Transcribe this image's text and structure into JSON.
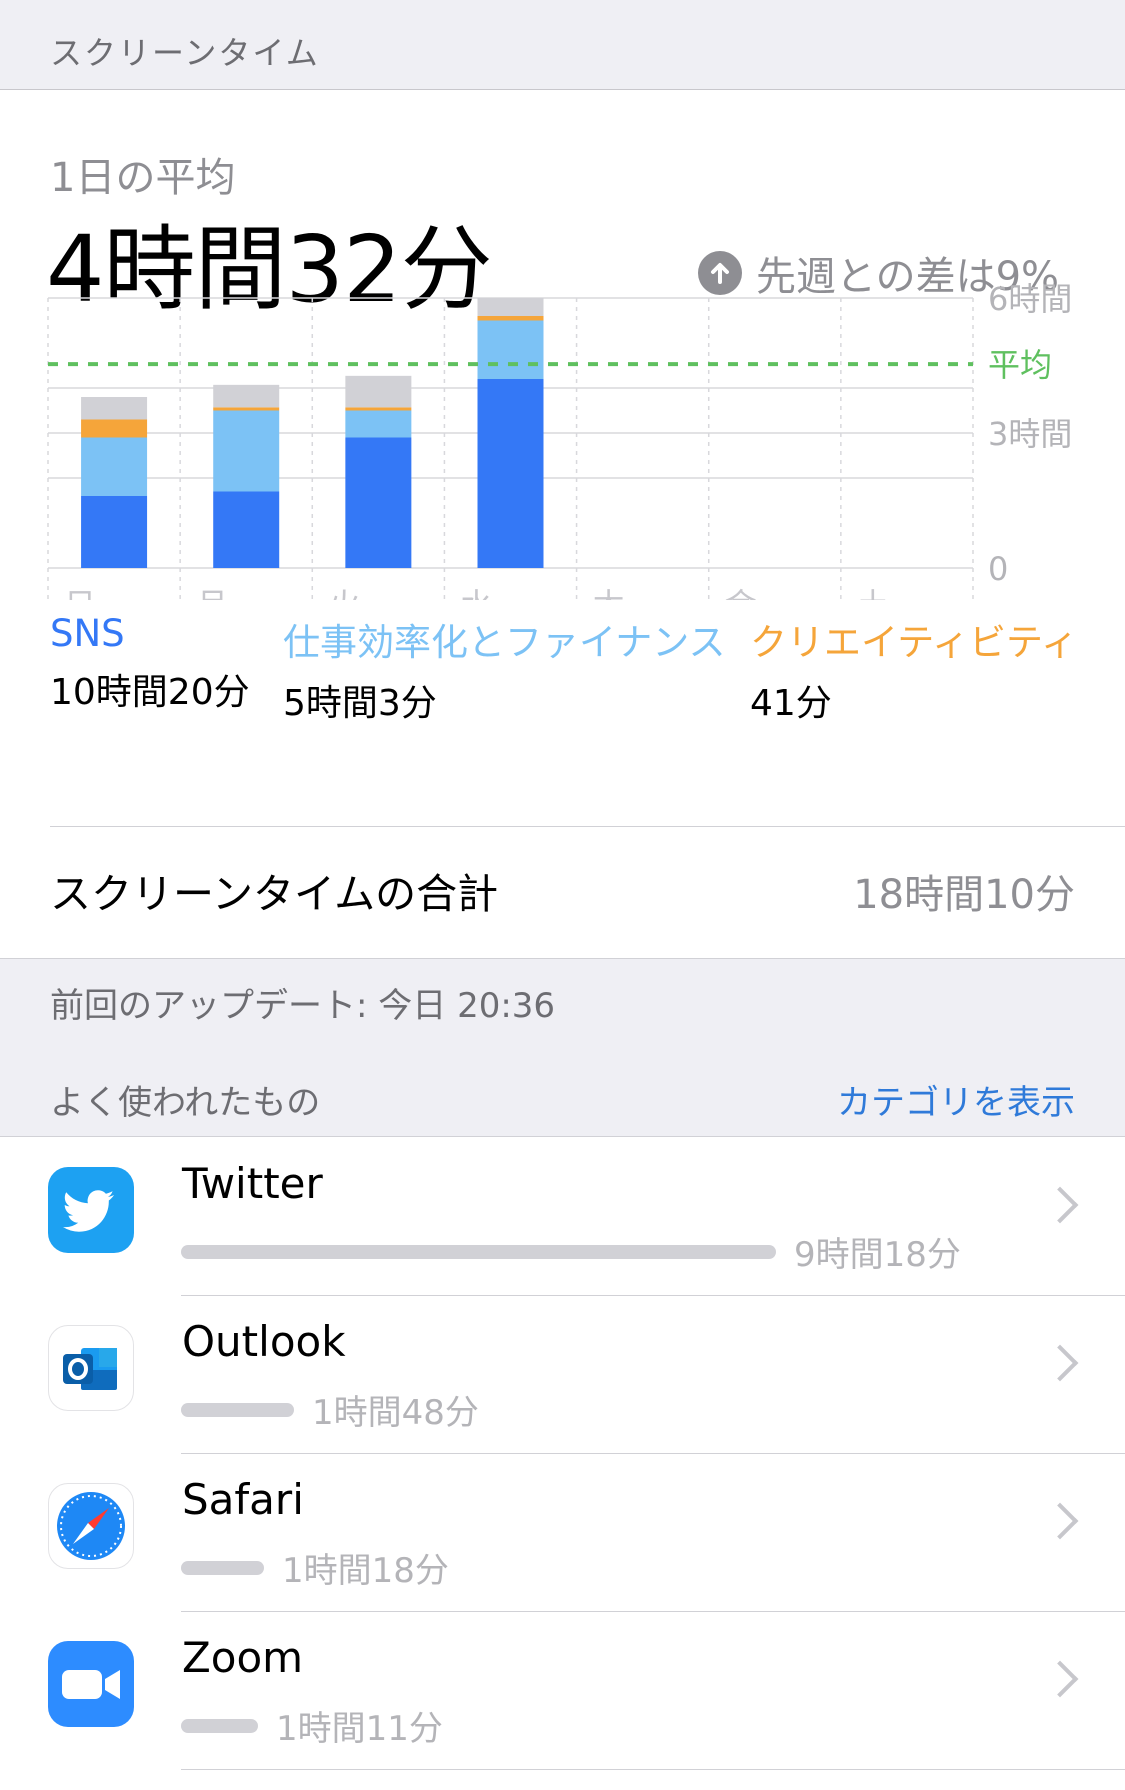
{
  "header": {
    "title": "スクリーンタイム"
  },
  "summary": {
    "avg_label": "1日の平均",
    "avg_value": "4時間32分",
    "diff_text": "先週との差は9%",
    "diff_icon": "arrow-up-circle-icon"
  },
  "chart_data": {
    "type": "bar",
    "stacked": true,
    "categories": [
      "日",
      "月",
      "火",
      "水",
      "木",
      "金",
      "土"
    ],
    "y_tick_labels": [
      "6時間",
      "平均",
      "3時間",
      "0"
    ],
    "y_ticks": [
      6,
      4.53,
      3,
      0
    ],
    "ylim": [
      0,
      6
    ],
    "average_line": 4.53,
    "series": [
      {
        "name": "SNS",
        "color": "#3478f6",
        "values": [
          1.6,
          1.7,
          2.9,
          4.2,
          0,
          0,
          0
        ]
      },
      {
        "name": "仕事効率化とファイナンス",
        "color": "#7cc2f5",
        "values": [
          1.3,
          1.8,
          0.6,
          1.3,
          0,
          0,
          0
        ]
      },
      {
        "name": "クリエイティビティ",
        "color": "#f5a53a",
        "values": [
          0.4,
          0.07,
          0.07,
          0.1,
          0,
          0,
          0
        ]
      },
      {
        "color": "#d1d1d6",
        "values": [
          0.5,
          0.5,
          0.7,
          0.4,
          0,
          0,
          0
        ]
      }
    ],
    "colors": {
      "average_line": "#5fc05f",
      "grid": "#d8d8dc"
    }
  },
  "legend": [
    {
      "name": "SNS",
      "value": "10時間20分",
      "color": "#3478f6"
    },
    {
      "name": "仕事効率化とファイナンス",
      "value": "5時間3分",
      "color": "#7cc2f5"
    },
    {
      "name": "クリエイティビティ",
      "value": "41分",
      "color": "#f5a53a"
    }
  ],
  "total": {
    "label": "スクリーンタイムの合計",
    "value": "18時間10分"
  },
  "update": {
    "text": "前回のアップデート: 今日 20:36"
  },
  "most_used": {
    "title": "よく使われたもの",
    "show_categories": "カテゴリを表示"
  },
  "apps": [
    {
      "name": "Twitter",
      "time": "9時間18分",
      "usage_fraction": 1.0,
      "icon": "twitter-icon",
      "icon_color": "#1da1f2"
    },
    {
      "name": "Outlook",
      "time": "1時間48分",
      "usage_fraction": 0.19,
      "icon": "outlook-icon",
      "icon_color": "#0f6cbd"
    },
    {
      "name": "Safari",
      "time": "1時間18分",
      "usage_fraction": 0.14,
      "icon": "safari-icon",
      "icon_color": "#1e88f5"
    },
    {
      "name": "Zoom",
      "time": "1時間11分",
      "usage_fraction": 0.13,
      "icon": "zoom-icon",
      "icon_color": "#2d8cff"
    }
  ]
}
